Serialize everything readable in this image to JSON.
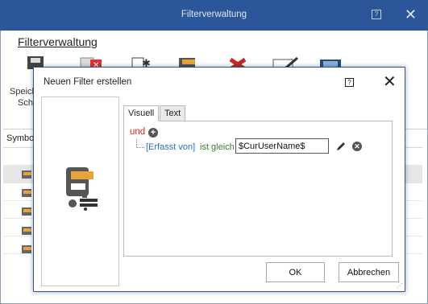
{
  "background_window": {
    "title": "Filterverwaltung",
    "ribbon_tab": "Filterverwaltung",
    "save_label_line1": "Speich",
    "save_label_line2": "Schl",
    "list_column_symbol": "Symbol",
    "row_count": 5
  },
  "dialog": {
    "title": "Neuen Filter erstellen",
    "help_label": "?",
    "close_label": "✕",
    "tabs": [
      {
        "label": "Visuell",
        "active": true
      },
      {
        "label": "Text",
        "active": false
      }
    ],
    "filter": {
      "operator": "und",
      "add_label": "+",
      "condition": {
        "field": "[Erfasst von]",
        "comparison": "ist gleich",
        "value": "$CurUserName$"
      },
      "remove_label": "✕"
    },
    "buttons": {
      "ok": "OK",
      "cancel": "Abbrechen"
    }
  },
  "colors": {
    "titlebar": "#2b579a",
    "operator": "#d02a1e",
    "field": "#2a6fbb",
    "comparison": "#3c7a2a"
  }
}
